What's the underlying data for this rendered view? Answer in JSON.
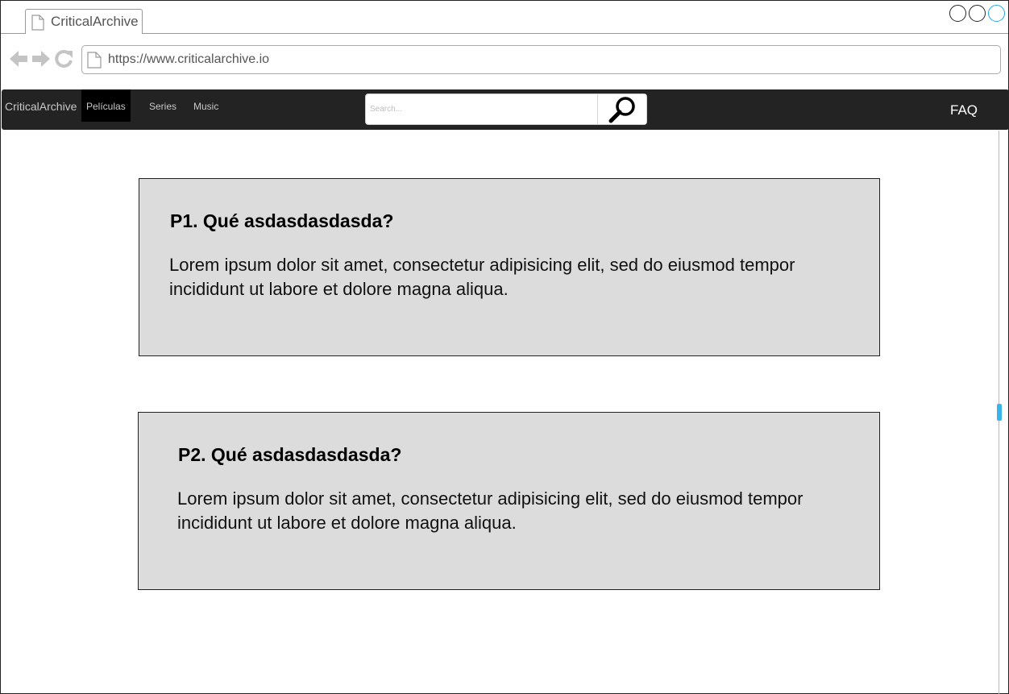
{
  "browser": {
    "tab_title": "CriticalArchive",
    "url": "https://www.criticalarchive.io"
  },
  "nav": {
    "brand": "CriticalArchive",
    "items": [
      {
        "label": "Películas",
        "active": true
      },
      {
        "label": "Series",
        "active": false
      },
      {
        "label": "Music",
        "active": false
      }
    ],
    "search_placeholder": "Search...",
    "faq_label": "FAQ"
  },
  "faq": [
    {
      "question": "P1. Qué asdasdasdasda?",
      "answer": "Lorem ipsum dolor sit amet, consectetur adipisicing elit, sed do eiusmod tempor incididunt ut labore et dolore magna aliqua."
    },
    {
      "question": "P2. Qué asdasdasdasda?",
      "answer": "Lorem ipsum dolor sit amet, consectetur adipisicing elit, sed do eiusmod tempor incididunt ut labore et dolore magna aliqua."
    }
  ],
  "colors": {
    "navbar": "#232323",
    "active_nav": "#000000",
    "card_bg": "#dcdcdc",
    "scroll_accent": "#38b5ea"
  }
}
